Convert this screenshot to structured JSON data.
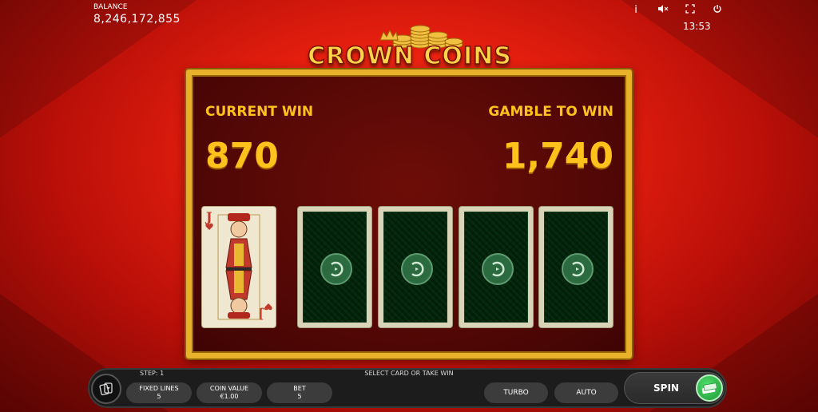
{
  "balance": {
    "label": "BALANCE",
    "value": "8,246,172,855"
  },
  "header_icons": [
    "info-icon",
    "mute-icon",
    "fullscreen-icon",
    "power-icon"
  ],
  "clock": "13:53",
  "logo": {
    "text": "CROWN COINS"
  },
  "gamble": {
    "current_win_label": "CURRENT WIN",
    "current_win_value": "870",
    "gamble_label": "GAMBLE TO WIN",
    "gamble_value": "1,740",
    "dealer_card": {
      "rank": "J",
      "suit": "hearts"
    },
    "face_down_cards": 4
  },
  "bottom": {
    "step": "STEP: 1",
    "instruction": "SELECT CARD OR TAKE WIN",
    "fixed_lines_label": "FIXED LINES",
    "fixed_lines_value": "5",
    "coin_value_label": "COIN VALUE",
    "coin_value_value": "€1.00",
    "bet_label": "BET",
    "bet_value": "5",
    "turbo_label": "TURBO",
    "auto_label": "AUTO",
    "spin_label": "SPIN"
  },
  "colors": {
    "accent_gold": "#ffc21c",
    "frame_gold": "#e8b12a",
    "spin_green": "#2fbf4c"
  }
}
